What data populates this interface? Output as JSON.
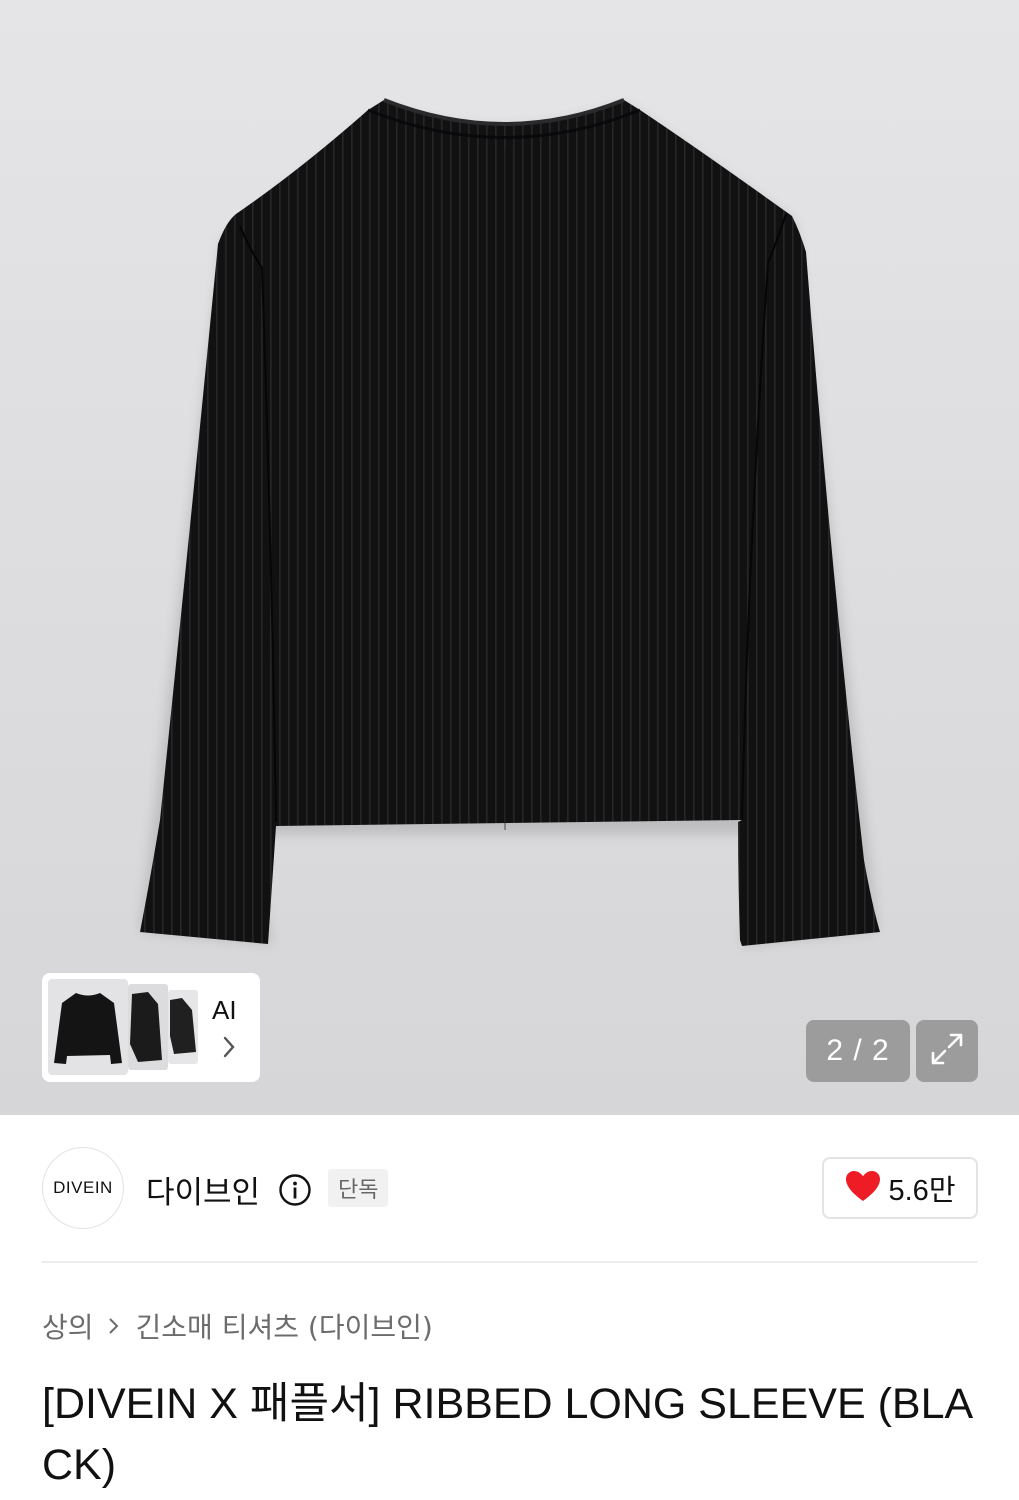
{
  "gallery": {
    "thumb_ai_label": "AI",
    "page_counter": "2 / 2",
    "icons": {
      "expand": "expand-arrows-icon",
      "next": "chevron-right-icon"
    }
  },
  "brand": {
    "logo_text": "DIVEIN",
    "name": "다이브인",
    "badge": "단독",
    "like_count": "5.6만",
    "icons": {
      "info": "info-circle-icon",
      "like": "heart-icon"
    },
    "like_color": "#ee1c25"
  },
  "breadcrumb": {
    "items": [
      "상의",
      "긴소매 티셔츠 (다이브인)"
    ]
  },
  "product": {
    "title": "[DIVEIN X 패플서] RIBBED LONG SLEEVE (BLACK)"
  }
}
